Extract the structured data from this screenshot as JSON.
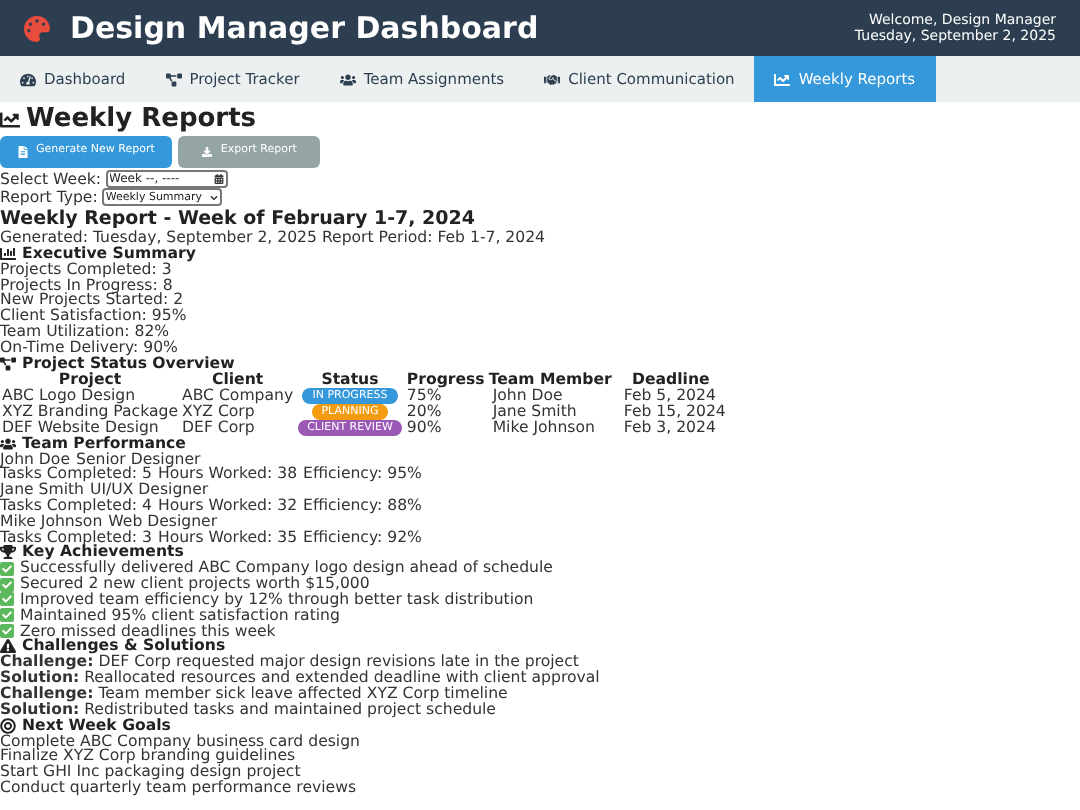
{
  "header": {
    "title": "Design Manager Dashboard",
    "welcome": "Welcome, Design Manager",
    "date": "Tuesday, September 2, 2025"
  },
  "tabs": [
    {
      "label": "Dashboard",
      "selected": false
    },
    {
      "label": "Project Tracker",
      "selected": false
    },
    {
      "label": "Team Assignments",
      "selected": false
    },
    {
      "label": "Client Communication",
      "selected": false
    },
    {
      "label": "Weekly Reports",
      "selected": true
    }
  ],
  "page_title": "Weekly Reports",
  "buttons": [
    {
      "label": "Generate New Report",
      "kind": "primary"
    },
    {
      "label": "Export Report",
      "kind": "secondary"
    }
  ],
  "week_field": {
    "label": "Select Week:",
    "placeholder": "Week --, ----"
  },
  "report_type": {
    "label": "Report Type:",
    "value": "Weekly Summary"
  },
  "report": {
    "title": "Weekly Report - Week of February 1-7, 2024",
    "meta": "Generated: Tuesday, September 2, 2025 Report Period: Feb 1-7, 2024"
  },
  "executive_summary": {
    "heading": "Executive Summary",
    "items": [
      "Projects Completed: 3",
      "Projects In Progress: 8",
      "New Projects Started: 2",
      "Client Satisfaction: 95%",
      "Team Utilization: 82%",
      "On-Time Delivery: 90%"
    ]
  },
  "project_status": {
    "heading": "Project Status Overview",
    "columns": [
      "Project",
      "Client",
      "Status",
      "Progress",
      "Team Member",
      "Deadline"
    ],
    "rows": [
      {
        "project": "ABC Logo Design",
        "client": "ABC Company",
        "status": "IN PROGRESS",
        "color": "#3498db",
        "progress": "75%",
        "member": "John Doe",
        "deadline": "Feb 5, 2024"
      },
      {
        "project": "XYZ Branding Package",
        "client": "XYZ Corp",
        "status": "PLANNING",
        "color": "#f39c12",
        "progress": "20%",
        "member": "Jane Smith",
        "deadline": "Feb 15, 2024"
      },
      {
        "project": "DEF Website Design",
        "client": "DEF Corp",
        "status": "CLIENT REVIEW",
        "color": "#9b59b6",
        "progress": "90%",
        "member": "Mike Johnson",
        "deadline": "Feb 3, 2024"
      }
    ]
  },
  "team_performance": {
    "heading": "Team Performance",
    "members": [
      {
        "name": "John Doe",
        "role": "Senior Designer",
        "stats": [
          "Tasks Completed: 5",
          "Hours Worked: 38",
          "Efficiency: 95%"
        ]
      },
      {
        "name": "Jane Smith",
        "role": "UI/UX Designer",
        "stats": [
          "Tasks Completed: 4",
          "Hours Worked: 32",
          "Efficiency: 88%"
        ]
      },
      {
        "name": "Mike Johnson",
        "role": "Web Designer",
        "stats": [
          "Tasks Completed: 3",
          "Hours Worked: 35",
          "Efficiency: 92%"
        ]
      }
    ]
  },
  "key_achievements": {
    "heading": "Key Achievements",
    "items": [
      "Successfully delivered ABC Company logo design ahead of schedule",
      "Secured 2 new client projects worth $15,000",
      "Improved team efficiency by 12% through better task distribution",
      "Maintained 95% client satisfaction rating",
      "Zero missed deadlines this week"
    ]
  },
  "challenges": {
    "heading": "Challenges & Solutions",
    "items": [
      "**Challenge:** DEF Corp requested major design revisions late in the project",
      "**Solution:** Reallocated resources and extended deadline with client approval",
      "**Challenge:** Team member sick leave affected XYZ Corp timeline",
      "**Solution:** Redistributed tasks and maintained project schedule"
    ]
  },
  "next_week_goals": {
    "heading": "Next Week Goals",
    "items": [
      "Complete ABC Company business card design",
      "Finalize XYZ Corp branding guidelines",
      "Start GHI Inc packaging design project",
      "Conduct quarterly team performance reviews"
    ]
  }
}
